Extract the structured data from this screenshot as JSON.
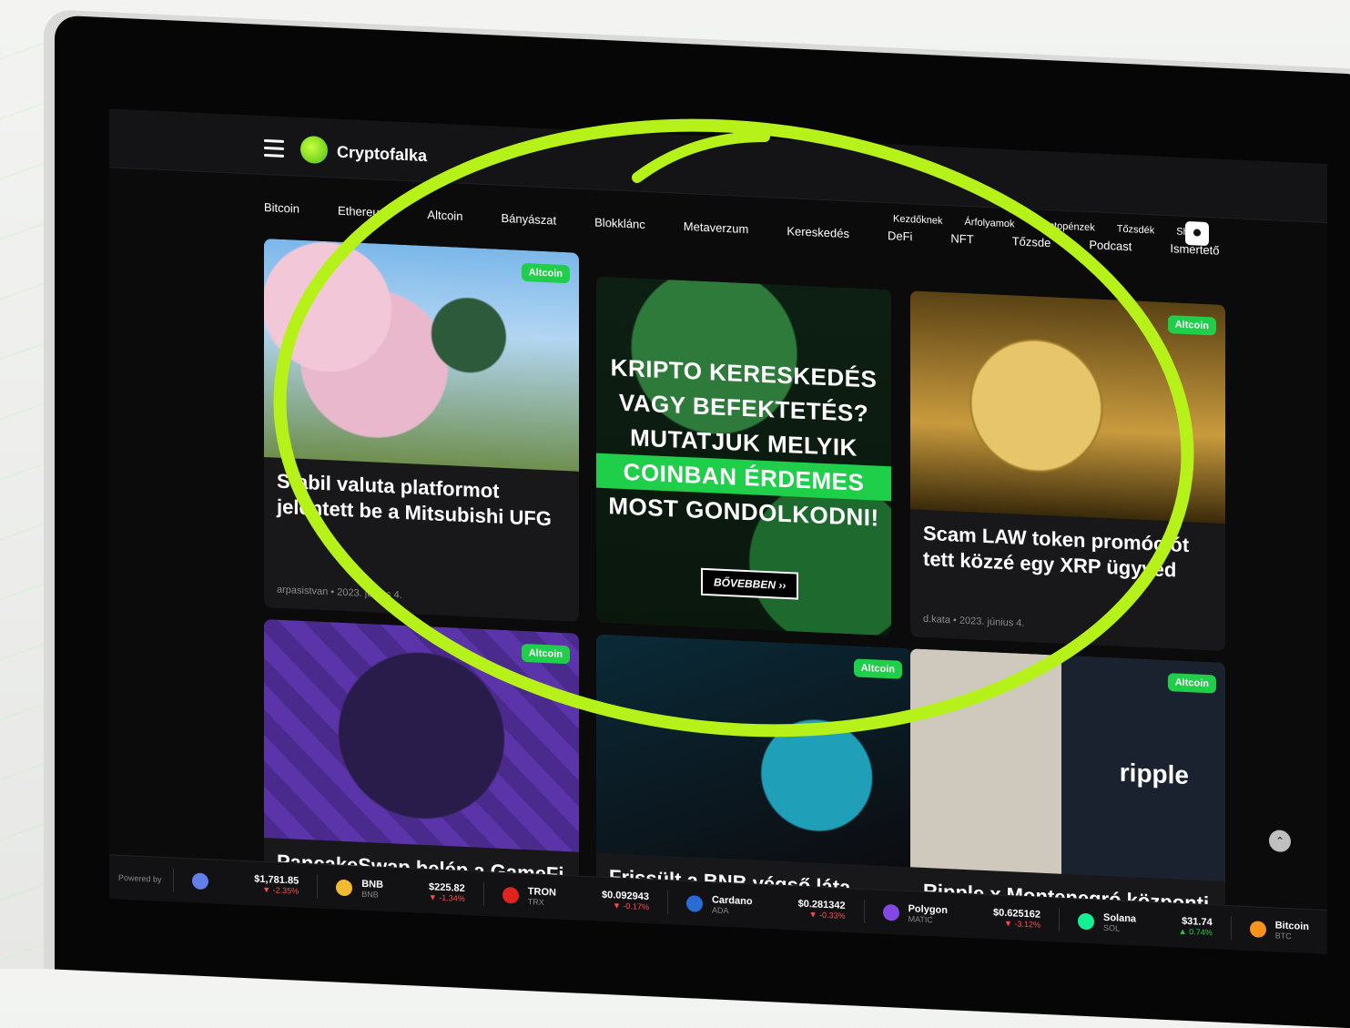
{
  "app": {
    "logo_text": "Cryptofalka"
  },
  "top_links": [
    "Kezdőknek",
    "Árfolyamok",
    "Kriptopénzek",
    "Tőzsdék",
    "Shop"
  ],
  "categories": [
    "Bitcoin",
    "Ethereum",
    "Altcoin",
    "Bányászat",
    "Blokklánc",
    "Metaverzum",
    "Kereskedés",
    "DeFi",
    "NFT",
    "Tőzsde",
    "Podcast",
    "Ismertető"
  ],
  "cards": [
    {
      "badge": "Altcoin",
      "title": "Stabil valuta platformot jelentett be a Mitsubishi UFG",
      "meta": "arpasistvan • 2023. június 4."
    },
    {
      "badge": "Altcoin",
      "title": "Scam LAW token promóciót tett közzé egy XRP ügyvéd",
      "meta": "d.kata • 2023. június 4."
    },
    {
      "badge": "Altcoin",
      "title": "PancakeSwap belép a GameFi",
      "meta": ""
    },
    {
      "badge": "Altcoin",
      "title": "Frissült a BNB végső láta",
      "meta": ""
    },
    {
      "badge": "Altcoin",
      "title": "Ripple x Montenegró központi",
      "meta": "",
      "logo": "ripple"
    }
  ],
  "ad": {
    "lines": [
      "KRIPTO KERESKEDÉS",
      "VAGY BEFEKTETÉS?",
      "MUTATJUK MELYIK",
      "COINBAN ÉRDEMES",
      "MOST GONDOLKODNI!"
    ],
    "button": "BŐVEBBEN ››"
  },
  "ticker": {
    "powered": "Powered by",
    "items": [
      {
        "name": "",
        "sym": "",
        "price": "$1,781.85",
        "chg": "▼ -2.35%",
        "color": "#627eea",
        "down": true
      },
      {
        "name": "BNB",
        "sym": "BNB",
        "price": "$225.82",
        "chg": "▼ -1.34%",
        "color": "#f3ba2f",
        "down": true
      },
      {
        "name": "TRON",
        "sym": "TRX",
        "price": "$0.092943",
        "chg": "▼ -0.17%",
        "color": "#e1231f",
        "down": true
      },
      {
        "name": "Cardano",
        "sym": "ADA",
        "price": "$0.281342",
        "chg": "▼ -0.33%",
        "color": "#2a6bd6",
        "down": true
      },
      {
        "name": "Polygon",
        "sym": "MATIC",
        "price": "$0.625162",
        "chg": "▼ -3.12%",
        "color": "#8247e5",
        "down": true
      },
      {
        "name": "Solana",
        "sym": "SOL",
        "price": "$31.74",
        "chg": "▲ 0.74%",
        "color": "#14f195",
        "down": false
      },
      {
        "name": "Bitcoin",
        "sym": "BTC",
        "price": "",
        "chg": "",
        "color": "#f7931a",
        "down": false
      }
    ]
  },
  "colors": {
    "accent": "#1fcf49",
    "highlight": "#b6f21a"
  }
}
